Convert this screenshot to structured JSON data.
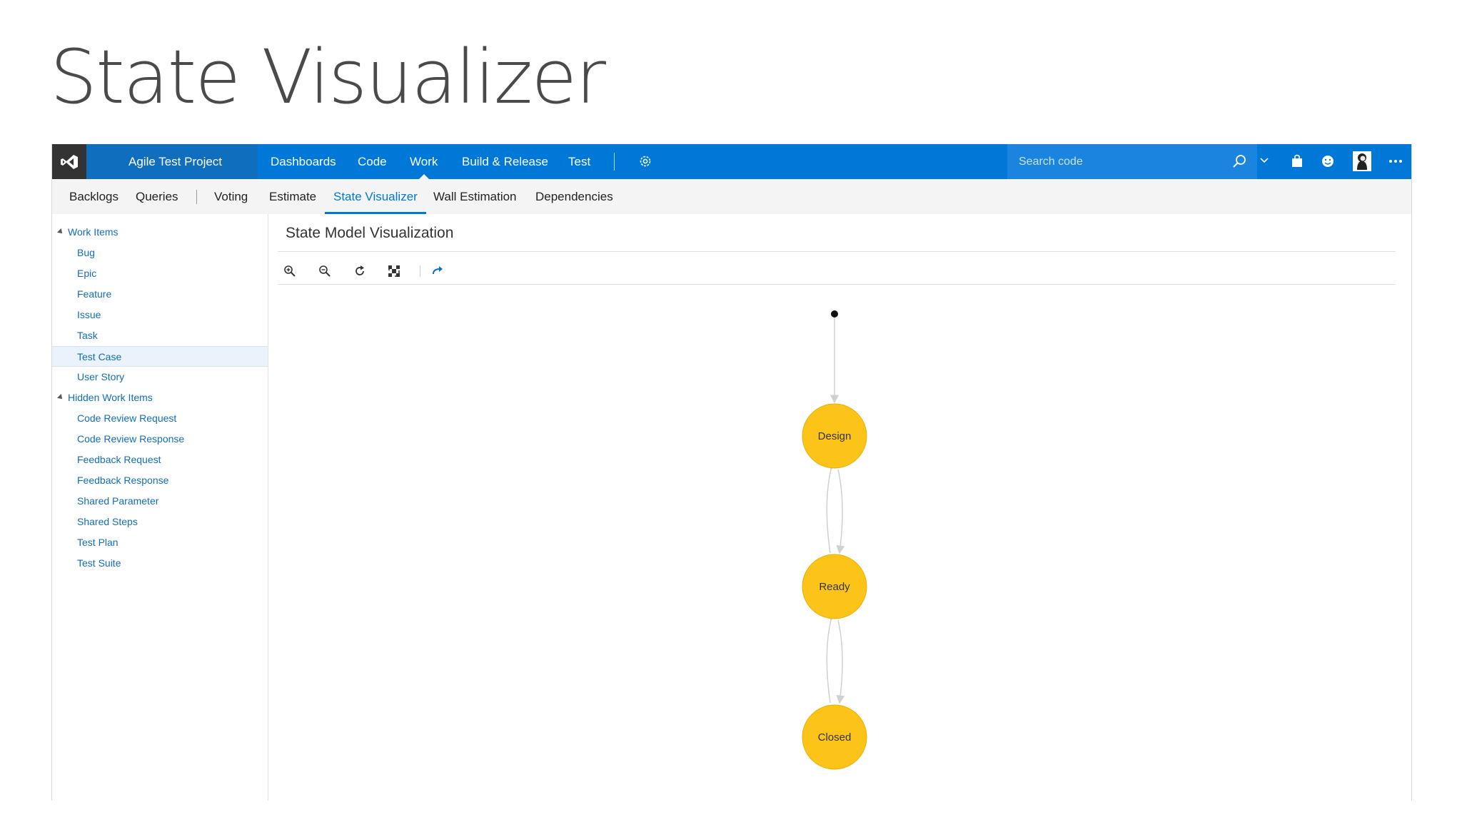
{
  "slide": {
    "title": "State Visualizer"
  },
  "topbar": {
    "project": "Agile Test Project",
    "nav": [
      "Dashboards",
      "Code",
      "Work",
      "Build & Release",
      "Test"
    ],
    "active_nav": "Work",
    "search_placeholder": "Search code",
    "icons": [
      "vs-logo",
      "settings-gear-icon",
      "search-icon",
      "chevron-down-icon",
      "shopping-bag-icon",
      "smiley-icon",
      "avatar",
      "more-icon"
    ]
  },
  "subnav": {
    "items": [
      "Backlogs",
      "Queries",
      "Voting",
      "Estimate",
      "State Visualizer",
      "Wall Estimation",
      "Dependencies"
    ],
    "active": "State Visualizer"
  },
  "tree": {
    "groups": [
      {
        "label": "Work Items",
        "items": [
          "Bug",
          "Epic",
          "Feature",
          "Issue",
          "Task",
          "Test Case",
          "User Story"
        ]
      },
      {
        "label": "Hidden Work Items",
        "items": [
          "Code Review Request",
          "Code Review Response",
          "Feedback Request",
          "Feedback Response",
          "Shared Parameter",
          "Shared Steps",
          "Test Plan",
          "Test Suite"
        ]
      }
    ],
    "selected": "Test Case"
  },
  "content": {
    "title": "State Model Visualization",
    "toolbar": [
      "zoom-in-icon",
      "zoom-out-icon",
      "refresh-icon",
      "fit-to-screen-icon",
      "redo-icon"
    ]
  },
  "graph": {
    "node_color": "#fcc419",
    "states": [
      "Design",
      "Ready",
      "Closed"
    ]
  }
}
